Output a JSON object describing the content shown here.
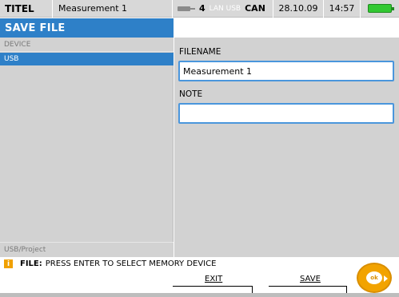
{
  "statusbar": {
    "titel": "TITEL",
    "name": "Measurement 1",
    "channel_num": "4",
    "lan_usb": "LAN USB",
    "can": "CAN",
    "date": "28.10.09",
    "time": "14:57"
  },
  "page": {
    "title": "SAVE FILE"
  },
  "left": {
    "device_header": "DEVICE",
    "devices": [
      "USB"
    ],
    "path": "USB/Project"
  },
  "form": {
    "filename_label": "FILENAME",
    "filename_value": "Measurement 1",
    "note_label": "NOTE",
    "note_value": ""
  },
  "info": {
    "icon": "i",
    "prefix": "FILE:",
    "message": "PRESS ENTER TO SELECT MEMORY DEVICE"
  },
  "softkeys": {
    "exit": "EXIT",
    "save": "SAVE"
  },
  "ok_dial": {
    "label": "ok"
  },
  "colors": {
    "accent": "#2e80c8",
    "battery": "#32c832",
    "dial": "#f2a300"
  }
}
